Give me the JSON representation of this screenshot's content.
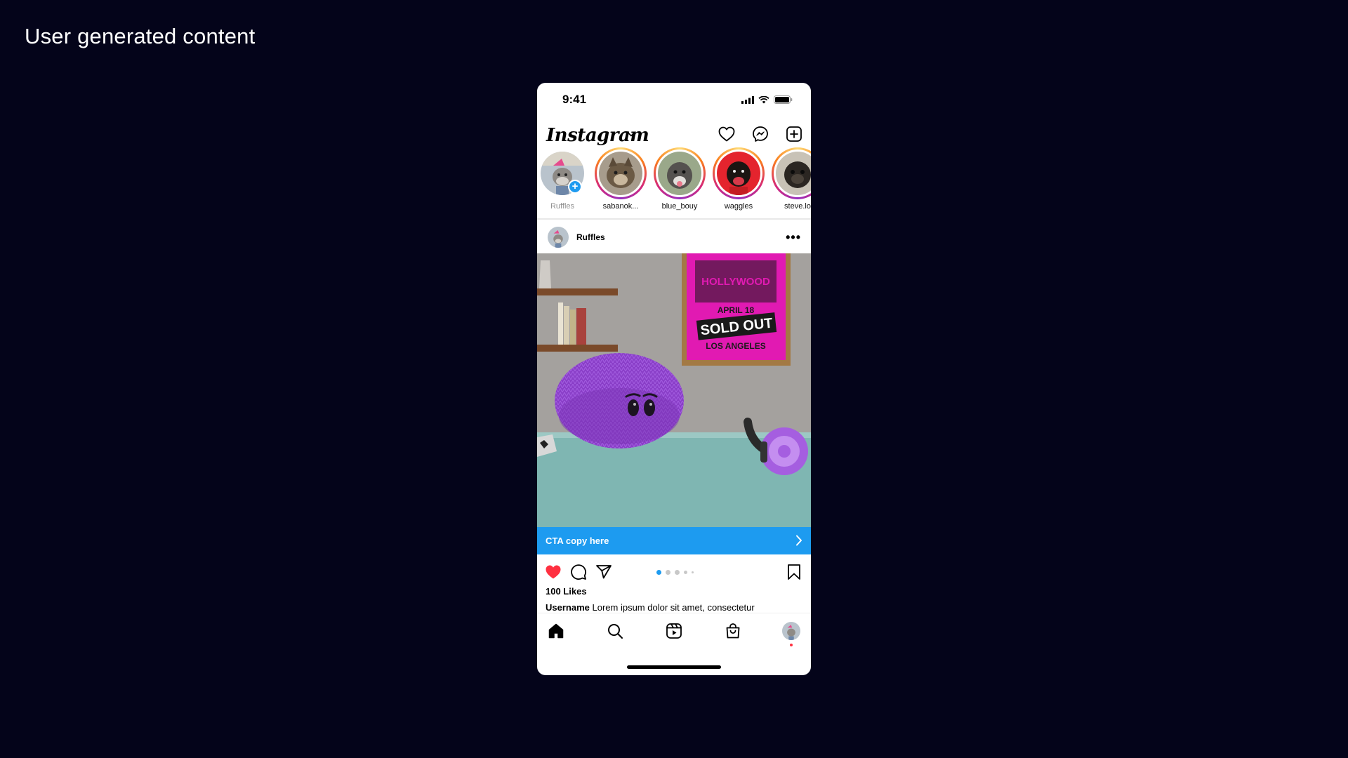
{
  "page": {
    "title": "User generated content"
  },
  "status_bar": {
    "time": "9:41"
  },
  "header": {
    "logo": "Instagram",
    "icons": [
      "chevron-down-icon",
      "heart-icon",
      "messenger-icon",
      "new-post-icon"
    ]
  },
  "stories": [
    {
      "name": "Ruffles",
      "own": true
    },
    {
      "name": "sabanok...",
      "own": false
    },
    {
      "name": "blue_bouy",
      "own": false
    },
    {
      "name": "waggles",
      "own": false
    },
    {
      "name": "steve.lo",
      "own": false
    }
  ],
  "post": {
    "username": "Ruffles",
    "more_icon": "•••",
    "image": {
      "poster_line1": "HOLLYWOOD",
      "poster_line2": "APRIL 18",
      "poster_line3": "SOLD OUT",
      "poster_line4": "LOS ANGELES"
    },
    "cta": {
      "label": "CTA copy here"
    },
    "carousel": {
      "total": 4,
      "active": 1
    },
    "likes": "100 Likes",
    "caption_user": "Username",
    "caption_text": "Lorem ipsum dolor sit amet, consectetur"
  },
  "bottom_nav": {
    "items": [
      "home-icon",
      "search-icon",
      "reels-icon",
      "shop-icon",
      "profile-avatar"
    ]
  },
  "colors": {
    "background": "#04041a",
    "cta": "#1d9bf0",
    "like": "#ff3040",
    "carousel_active": "#1d9bf0"
  }
}
